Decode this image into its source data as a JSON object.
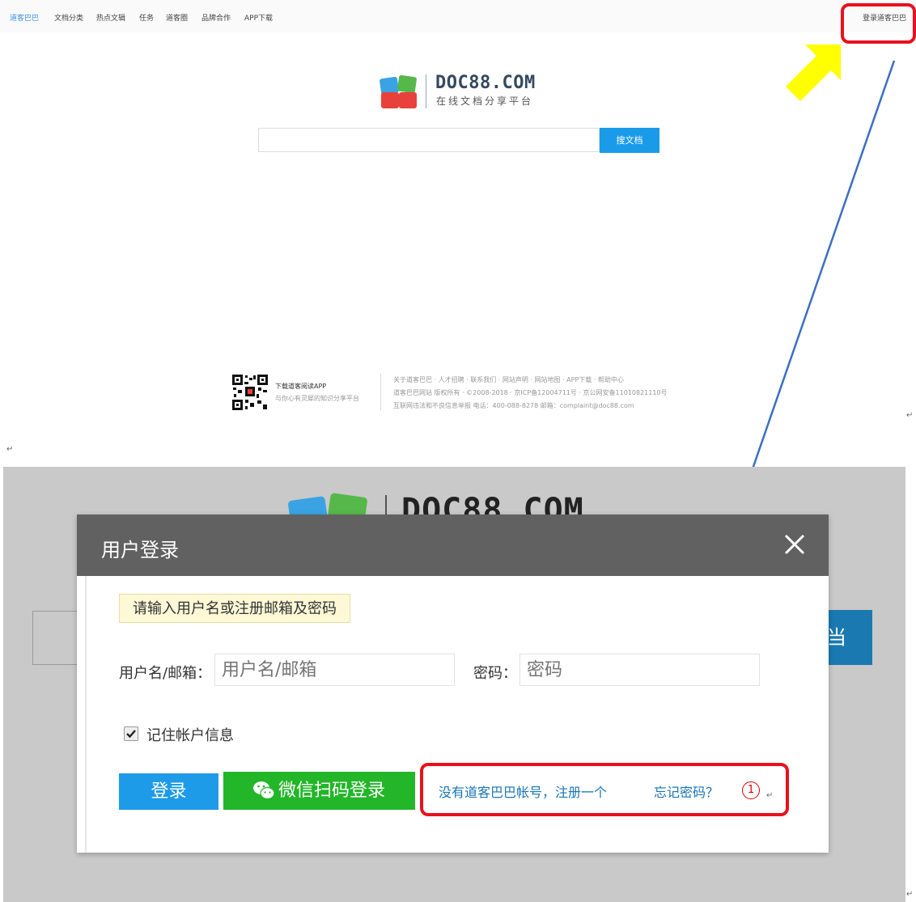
{
  "top": {
    "nav": [
      "道客巴巴",
      "文档分类",
      "热点文辑",
      "任务",
      "道客圈",
      "品牌合作",
      "APP下载"
    ],
    "login": "登录道客巴巴",
    "logo_text": "DOC88.COM",
    "logo_sub": "在线文档分享平台",
    "search_btn": "搜文档",
    "footer_app_title": "下载道客阅读APP",
    "footer_app_sub": "与你心有灵犀的知识分享平台",
    "footer_lines": [
      "关于道客巴巴 · 人才招聘 · 联系我们 · 网站声明 · 网站地图 · APP下载 · 帮助中心",
      "道客巴巴网站 版权所有 · ©2008-2018 · 京ICP备12004711号 · 京公网安备11010821110号",
      "互联网违法和不良信息举报  电话：400-088-8278  邮箱：complaint@doc88.com"
    ]
  },
  "bottom": {
    "logo_text": "DOC88.COM",
    "bg_button_text": "当",
    "modal": {
      "title": "用户登录",
      "hint": "请输入用户名或注册邮箱及密码",
      "username_label": "用户名/邮箱：",
      "username_placeholder": "用户名/邮箱",
      "password_label": "密码：",
      "password_placeholder": "密码",
      "remember_label": "记住帐户信息",
      "remember_checked": true,
      "login_btn": "登录",
      "wechat_btn": "微信扫码登录",
      "register_link": "没有道客巴巴帐号，注册一个",
      "forgot_link": "忘记密码？",
      "step_marker": "1"
    }
  },
  "colors": {
    "annotation_red": "#e8111c",
    "arrow_blue": "#3b6fc2",
    "arrow_yellow": "#ffff00",
    "primary_blue": "#1d9be8",
    "wechat_green": "#22b628"
  }
}
